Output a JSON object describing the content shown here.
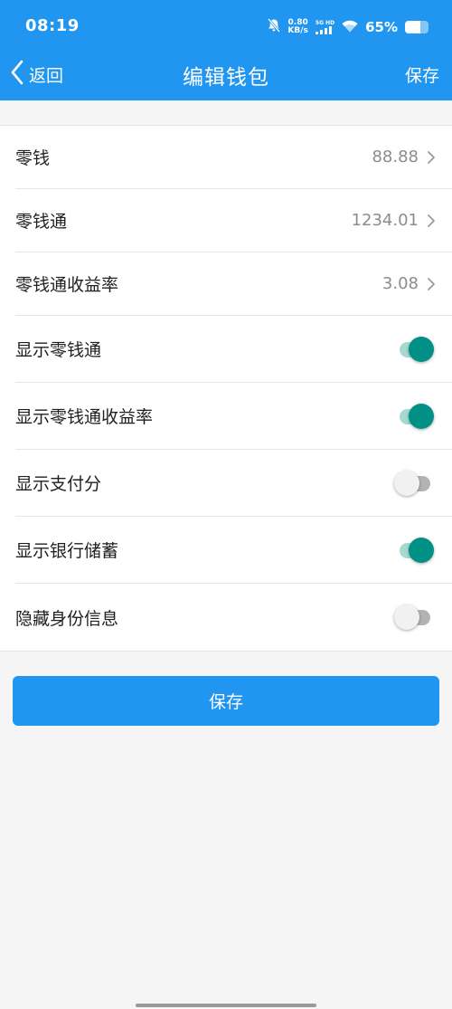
{
  "status_bar": {
    "time": "08:19",
    "net_speed_value": "0.80",
    "net_speed_unit": "KB/s",
    "network_type": "5G HD",
    "battery_percent": "65%",
    "battery_level": 0.65,
    "icons": [
      "mute-bell-icon",
      "signal-icon",
      "wifi-icon",
      "battery-icon"
    ]
  },
  "nav": {
    "back_label": "返回",
    "title": "编辑钱包",
    "save_label": "保存"
  },
  "rows": [
    {
      "label": "零钱",
      "value": "88.88"
    },
    {
      "label": "零钱通",
      "value": "1234.01"
    },
    {
      "label": "零钱通收益率",
      "value": "3.08"
    }
  ],
  "toggles": [
    {
      "label": "显示零钱通",
      "on": true
    },
    {
      "label": "显示零钱通收益率",
      "on": true
    },
    {
      "label": "显示支付分",
      "on": false
    },
    {
      "label": "显示银行储蓄",
      "on": true
    },
    {
      "label": "隐藏身份信息",
      "on": false
    }
  ],
  "save_button": {
    "label": "保存"
  },
  "colors": {
    "header_bg": "#2196f0",
    "toggle_on_thumb": "#009085",
    "toggle_on_track": "#a7d9d3",
    "toggle_off_thumb": "#f1f1f1",
    "toggle_off_track": "#b3b3b3",
    "page_bg": "#f5f5f6"
  }
}
